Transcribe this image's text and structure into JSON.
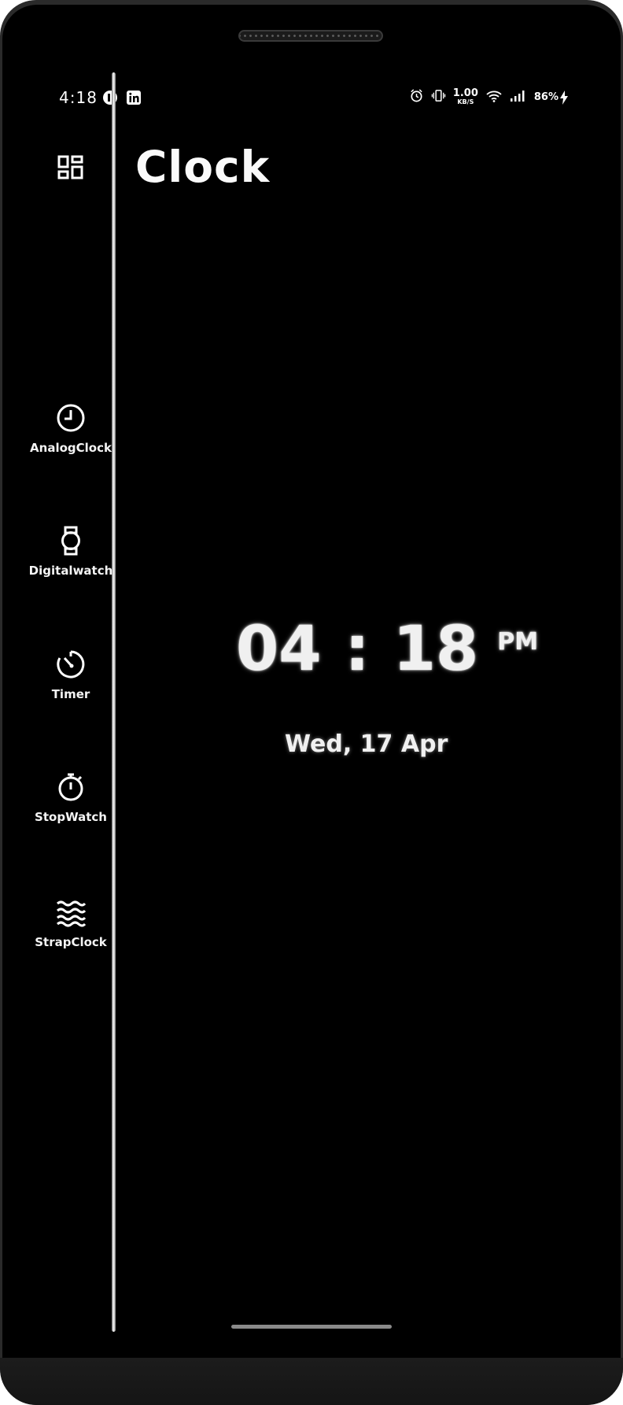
{
  "status_bar": {
    "time": "4:18",
    "net_speed_value": "1.00",
    "net_speed_unit": "KB/S",
    "battery": "86%",
    "icons": [
      "app-circle-icon",
      "linkedin-icon",
      "alarm-icon",
      "vibrate-icon",
      "wifi-icon",
      "signal-icon",
      "charging-icon"
    ]
  },
  "app": {
    "title": "Clock",
    "top_icon": "dashboard-icon"
  },
  "nav": {
    "items": [
      {
        "label": "AnalogClock",
        "icon": "analog-clock-icon"
      },
      {
        "label": "Digitalwatch",
        "icon": "watch-icon"
      },
      {
        "label": "Timer",
        "icon": "timer-icon"
      },
      {
        "label": "StopWatch",
        "icon": "stopwatch-icon"
      },
      {
        "label": "StrapClock",
        "icon": "waves-icon"
      }
    ]
  },
  "clock": {
    "hours": "04",
    "separator": ":",
    "minutes": "18",
    "ampm": "PM",
    "date": "Wed, 17 Apr"
  },
  "colors": {
    "background": "#000000",
    "text": "#ffffff",
    "frame": "#2a2a2a"
  }
}
